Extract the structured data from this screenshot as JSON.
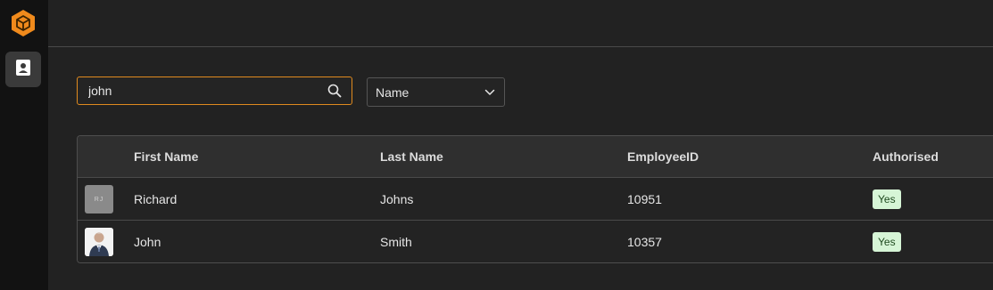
{
  "sidebar": {
    "logo_icon": "cube-logo-icon",
    "items": [
      {
        "icon": "contact-card-icon",
        "active": true
      }
    ]
  },
  "search": {
    "value": "john",
    "placeholder": "",
    "icon": "search-icon"
  },
  "filter": {
    "selected": "Name",
    "icon": "chevron-down-icon"
  },
  "table": {
    "columns": [
      "First Name",
      "Last Name",
      "EmployeeID",
      "Authorised"
    ],
    "rows": [
      {
        "avatar_initials": "RJ",
        "avatar_type": "initials",
        "first_name": "Richard",
        "last_name": "Johns",
        "employee_id": "10951",
        "authorised": "Yes"
      },
      {
        "avatar_initials": "",
        "avatar_type": "photo",
        "first_name": "John",
        "last_name": "Smith",
        "employee_id": "10357",
        "authorised": "Yes"
      }
    ]
  },
  "colors": {
    "accent": "#e08a1e",
    "badge_bg": "#d6f5d6",
    "background": "#222222",
    "sidebar_bg": "#121212"
  }
}
